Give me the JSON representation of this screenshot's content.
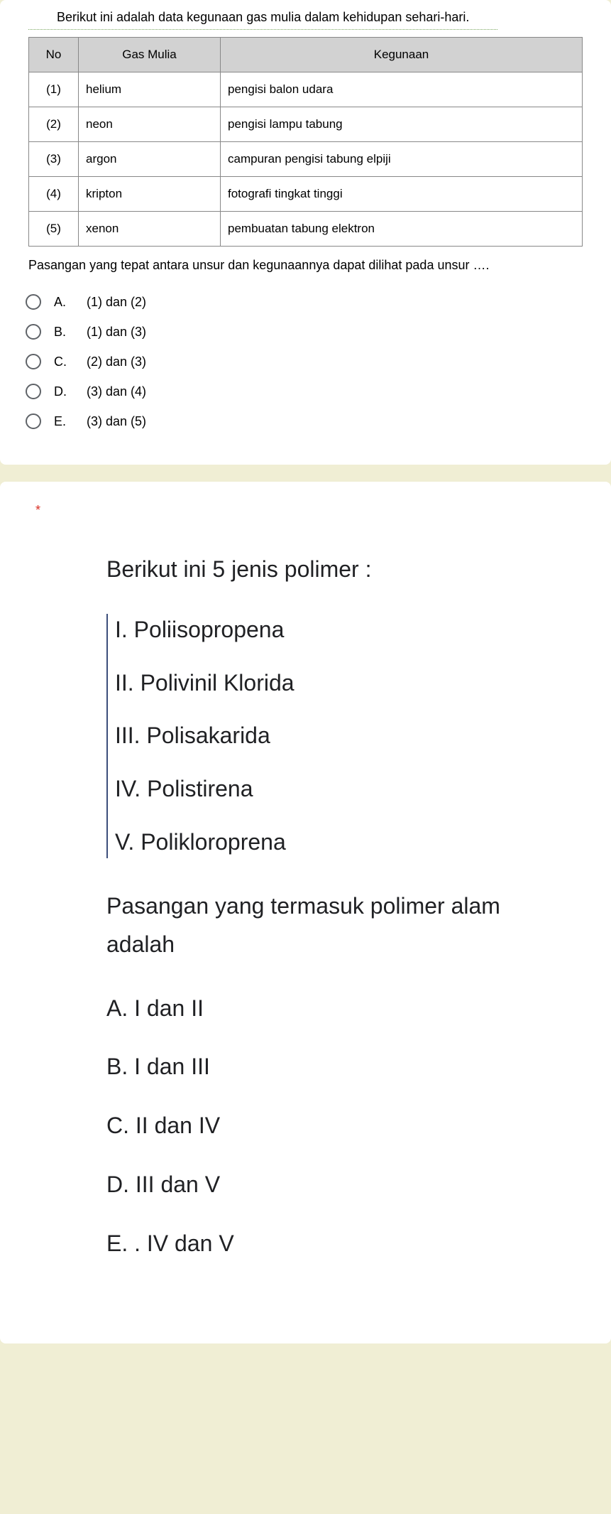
{
  "q1": {
    "intro": "Berikut ini adalah data kegunaan gas mulia dalam kehidupan sehari-hari.",
    "headers": {
      "no": "No",
      "gas": "Gas Mulia",
      "use": "Kegunaan"
    },
    "rows": [
      {
        "no": "(1)",
        "gas": "helium",
        "use": "pengisi balon udara"
      },
      {
        "no": "(2)",
        "gas": "neon",
        "use": "pengisi lampu tabung"
      },
      {
        "no": "(3)",
        "gas": "argon",
        "use": "campuran pengisi tabung elpiji"
      },
      {
        "no": "(4)",
        "gas": "kripton",
        "use": "fotografi tingkat tinggi"
      },
      {
        "no": "(5)",
        "gas": "xenon",
        "use": "pembuatan tabung elektron"
      }
    ],
    "followup": "Pasangan yang tepat antara unsur dan kegunaannya dapat dilihat pada unsur ….",
    "options": [
      {
        "letter": "A.",
        "text": "(1) dan (2)"
      },
      {
        "letter": "B.",
        "text": "(1) dan (3)"
      },
      {
        "letter": "C.",
        "text": "(2) dan (3)"
      },
      {
        "letter": "D.",
        "text": "(3) dan (4)"
      },
      {
        "letter": "E.",
        "text": "(3) dan (5)"
      }
    ]
  },
  "q2": {
    "required": "*",
    "intro": "Berikut ini 5 jenis polimer :",
    "polymers": [
      "I. Poliisopropena",
      "II. Polivinil Klorida",
      "III. Polisakarida",
      "IV. Polistirena",
      "V. Polikloroprena"
    ],
    "question": "Pasangan yang termasuk polimer alam adalah",
    "options": [
      "A. I dan II",
      "B. I dan III",
      "C. II dan IV",
      "D. III dan V",
      "E. . IV dan V"
    ]
  }
}
